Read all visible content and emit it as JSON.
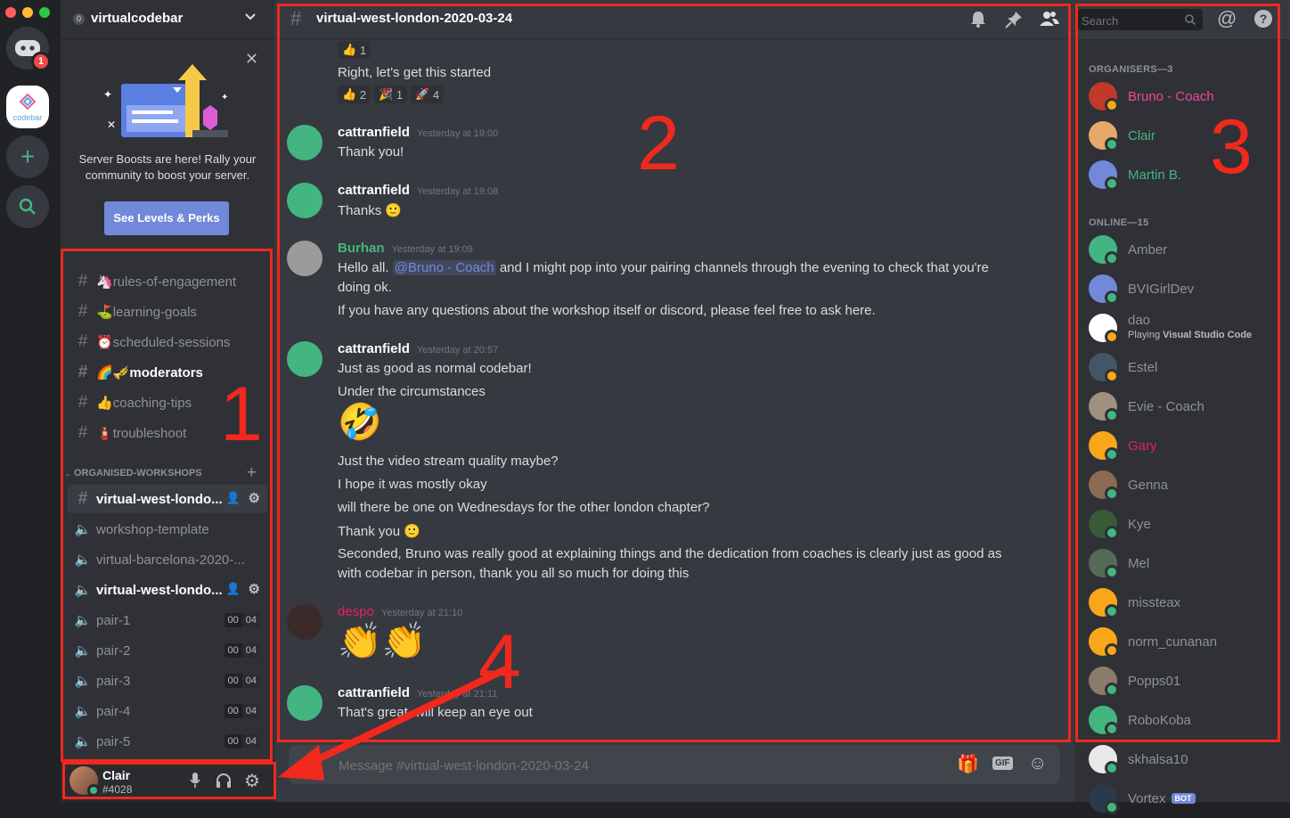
{
  "colors": {
    "accent": "#7289da",
    "green": "#43b581",
    "annotation_red": "#f1281d",
    "pink": "#e91e63",
    "organiser_pink": "#f0479a"
  },
  "rail": {
    "notification_count": "1",
    "server_label": "codebar"
  },
  "sidebar": {
    "server_name": "virtualcodebar",
    "server_prefix": "0",
    "boost": {
      "text": "Server Boosts are here! Rally your community to boost your server.",
      "button": "See Levels & Perks"
    },
    "channels": [
      {
        "emoji": "🦄",
        "name": "rules-of-engagement"
      },
      {
        "emoji": "⛳",
        "name": "learning-goals"
      },
      {
        "emoji": "⏰",
        "name": "scheduled-sessions"
      },
      {
        "emoji": "🌈🎺",
        "name": "moderators"
      },
      {
        "emoji": "👍",
        "name": "coaching-tips"
      },
      {
        "emoji": "🧯",
        "name": "troubleshoot"
      }
    ],
    "category": "ORGANISED-WORKSHOPS",
    "workshop_channels": [
      {
        "name": "virtual-west-londo..."
      },
      {
        "name": "workshop-template"
      },
      {
        "name": "virtual-barcelona-2020-..."
      },
      {
        "name": "virtual-west-londo..."
      },
      {
        "name": "pair-1",
        "a": "00",
        "b": "04"
      },
      {
        "name": "pair-2",
        "a": "00",
        "b": "04"
      },
      {
        "name": "pair-3",
        "a": "00",
        "b": "04"
      },
      {
        "name": "pair-4",
        "a": "00",
        "b": "04"
      },
      {
        "name": "pair-5",
        "a": "00",
        "b": "04"
      }
    ],
    "user": {
      "name": "Clair",
      "tag": "#4028"
    }
  },
  "chat": {
    "channel": "virtual-west-london-2020-03-24",
    "placeholder": "Message #virtual-west-london-2020-03-24",
    "top_reaction": "1",
    "first_line": "Right, let's get this started",
    "reactions": [
      {
        "e": "👍",
        "n": "2"
      },
      {
        "e": "🎉",
        "n": "1"
      },
      {
        "e": "🚀",
        "n": "4"
      }
    ],
    "messages": [
      {
        "author": "cattranfield",
        "time": "Yesterday at 19:00",
        "lines": [
          "Thank you!"
        ]
      },
      {
        "author": "cattranfield",
        "time": "Yesterday at 19:08",
        "lines": [
          "Thanks"
        ]
      },
      {
        "author": "Burhan",
        "time": "Yesterday at 19:09",
        "mention": "@Bruno - Coach",
        "pre": "Hello all.",
        "post": "and I might pop into your pairing channels through the evening to check that you're",
        "lines": [
          "doing ok.",
          "If you have any questions about the workshop itself or discord, please feel free to ask here."
        ]
      },
      {
        "author": "cattranfield",
        "time": "Yesterday at 20:57",
        "lines": [
          "Just as good as normal codebar!",
          "Under the circumstances",
          "Just the video stream quality maybe?",
          "I hope it was mostly okay",
          "will there be one on Wednesdays for the other london chapter?",
          "Thank you",
          "Seconded, Bruno was really good at explaining things and the dedication from coaches is clearly just as good as",
          "with codebar in person, thank you all so much for doing this"
        ]
      },
      {
        "author": "despo",
        "time": "Yesterday at 21:10",
        "lines": [
          "👏👏"
        ]
      },
      {
        "author": "cattranfield",
        "time": "Yesterday at 21:11",
        "lines": [
          "That's great, will keep an eye out"
        ]
      }
    ]
  },
  "members": {
    "search_placeholder": "Search",
    "organisers_title": "ORGANISERS—3",
    "organisers": [
      {
        "name": "Bruno - Coach"
      },
      {
        "name": "Clair"
      },
      {
        "name": "Martin B."
      }
    ],
    "online_title": "ONLINE—15",
    "online": [
      {
        "name": "Amber"
      },
      {
        "name": "BVIGirlDev"
      },
      {
        "name": "dao",
        "activity_pre": "Playing ",
        "activity": "Visual Studio Code"
      },
      {
        "name": "Estel"
      },
      {
        "name": "Evie - Coach"
      },
      {
        "name": "Gary"
      },
      {
        "name": "Genna"
      },
      {
        "name": "Kye"
      },
      {
        "name": "Mel"
      },
      {
        "name": "missteax"
      },
      {
        "name": "norm_cunanan"
      },
      {
        "name": "Popps01"
      },
      {
        "name": "RoboKoba"
      },
      {
        "name": "skhalsa10"
      },
      {
        "name": "Vortex",
        "bot": "BOT"
      }
    ]
  },
  "annotations": {
    "n1": "1",
    "n2": "2",
    "n3": "3",
    "n4": "4"
  }
}
